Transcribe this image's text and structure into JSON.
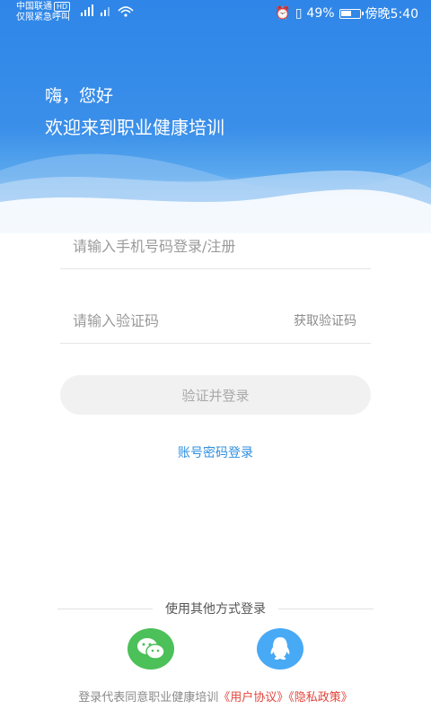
{
  "status_bar": {
    "carrier_line1": "中国联通",
    "hd_badge": "HD",
    "carrier_line2": "仅限紧急呼叫",
    "battery": "49%",
    "time": "傍晚5:40"
  },
  "greeting": {
    "line1": "嗨，您好",
    "line2": "欢迎来到职业健康培训"
  },
  "form": {
    "phone_placeholder": "请输入手机号码登录/注册",
    "code_placeholder": "请输入验证码",
    "get_code_label": "获取验证码",
    "submit_label": "验证并登录",
    "password_login_link": "账号密码登录"
  },
  "other_login": {
    "title": "使用其他方式登录",
    "options": [
      "wechat-icon",
      "qq-icon"
    ]
  },
  "agreement": {
    "prefix": "登录代表同意职业健康培训",
    "user_agreement": "《用户协议》",
    "privacy_policy": "《隐私政策》"
  },
  "colors": {
    "primary_blue": "#2f86e8",
    "link_blue": "#2f8fe0",
    "wechat_green": "#4cc059",
    "qq_blue": "#48a9f5",
    "policy_red": "#e2453c"
  }
}
